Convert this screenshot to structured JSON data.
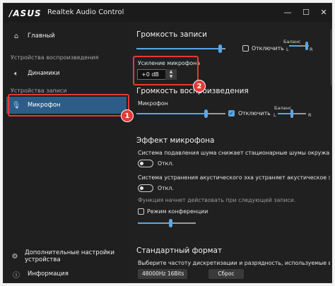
{
  "window": {
    "logo": "/ASUS",
    "title": "Realtek Audio Control",
    "controls": {
      "minimize": "—",
      "maximize": "☐",
      "close": "✕"
    }
  },
  "sidebar": {
    "home": "Главный",
    "section_playback": "Устройства воспроизведения",
    "speakers": "Динамики",
    "section_record": "Устройства записи",
    "microphone": "Микрофон",
    "advanced": "Дополнительные настройки устройства",
    "info": "Информация"
  },
  "badges": {
    "one": "1",
    "two": "2"
  },
  "main": {
    "record_volume_title": "Громкость записи",
    "balance_label_top": "Баланс",
    "mute_label_top": "Отключить",
    "left": "L",
    "right": "R",
    "mic_boost_label": "Усиление микрофона",
    "mic_boost_value": "+0 dB",
    "playback_volume_title": "Громкость воспроизведения",
    "mic_label": "Микрофон",
    "mute_label": "Отключить",
    "balance_label": "Баланс",
    "effect_title": "Эффект микрофона",
    "noise_suppression_text": "Система подавления шума снижает стационарные шумы окружающей среды, и",
    "noise_toggle_label": "Откл.",
    "echo_cancel_text": "Система устранения акустического эха устраняет акустическое эхо микрофонов",
    "echo_toggle_label": "Откл.",
    "echo_hint": "Функция начнет действовать при следующей записи.",
    "conference_label": "Режим конференции",
    "format_title": "Стандартный формат",
    "format_text": "Выберите частоту дискретизации и разрядность, используемые в режиме общего",
    "format_value": "48000Hz 16Bits",
    "reset_button": "Сброс"
  },
  "levels": {
    "record_volume": 0.95,
    "record_balance": 0.5,
    "mic_volume": 0.78,
    "mic_balance": 0.5,
    "conference_level": 0.4
  },
  "colors": {
    "accent": "#5aa7e8",
    "highlight": "#e53935",
    "active_nav": "#2d5d86"
  }
}
